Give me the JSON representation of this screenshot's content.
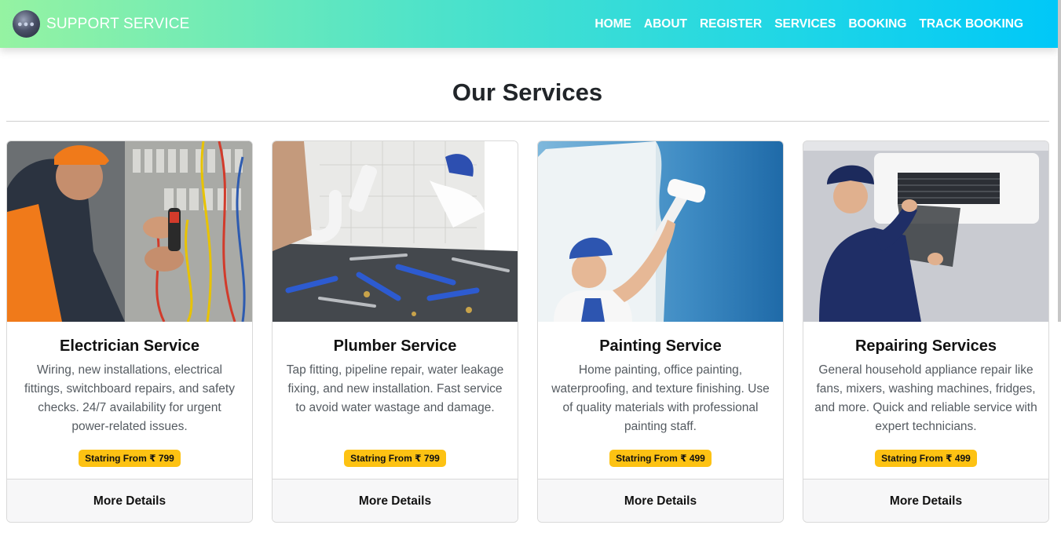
{
  "brand": {
    "name": "SUPPORT SERVICE",
    "logo_icon": "logo-icon"
  },
  "nav": {
    "items": [
      "HOME",
      "ABOUT",
      "REGISTER",
      "SERVICES",
      "BOOKING",
      "TRACK BOOKING"
    ]
  },
  "page": {
    "title": "Our Services"
  },
  "cards": [
    {
      "title": "Electrician Service",
      "text": "Wiring, new installations, electrical fittings, switchboard repairs, and safety checks. 24/7 availability for urgent power-related issues.",
      "price": "Statring From ₹ 799",
      "button": "More Details",
      "image": "electrician-photo"
    },
    {
      "title": "Plumber Service",
      "text": "Tap fitting, pipeline repair, water leakage fixing, and new installation. Fast service to avoid water wastage and damage.",
      "price": "Statring From ₹ 799",
      "button": "More Details",
      "image": "plumber-photo"
    },
    {
      "title": "Painting Service",
      "text": "Home painting, office painting, waterproofing, and texture finishing. Use of quality materials with professional painting staff.",
      "price": "Statring From ₹ 499",
      "button": "More Details",
      "image": "painter-photo"
    },
    {
      "title": "Repairing Services",
      "text": "General household appliance repair like fans, mixers, washing machines, fridges, and more. Quick and reliable service with expert technicians.",
      "price": "Statring From ₹ 499",
      "button": "More Details",
      "image": "ac-repair-photo"
    }
  ],
  "colors": {
    "badge": "#fdc213",
    "nav_gradient_start": "#95f3a2",
    "nav_gradient_end": "#00c8f8"
  }
}
